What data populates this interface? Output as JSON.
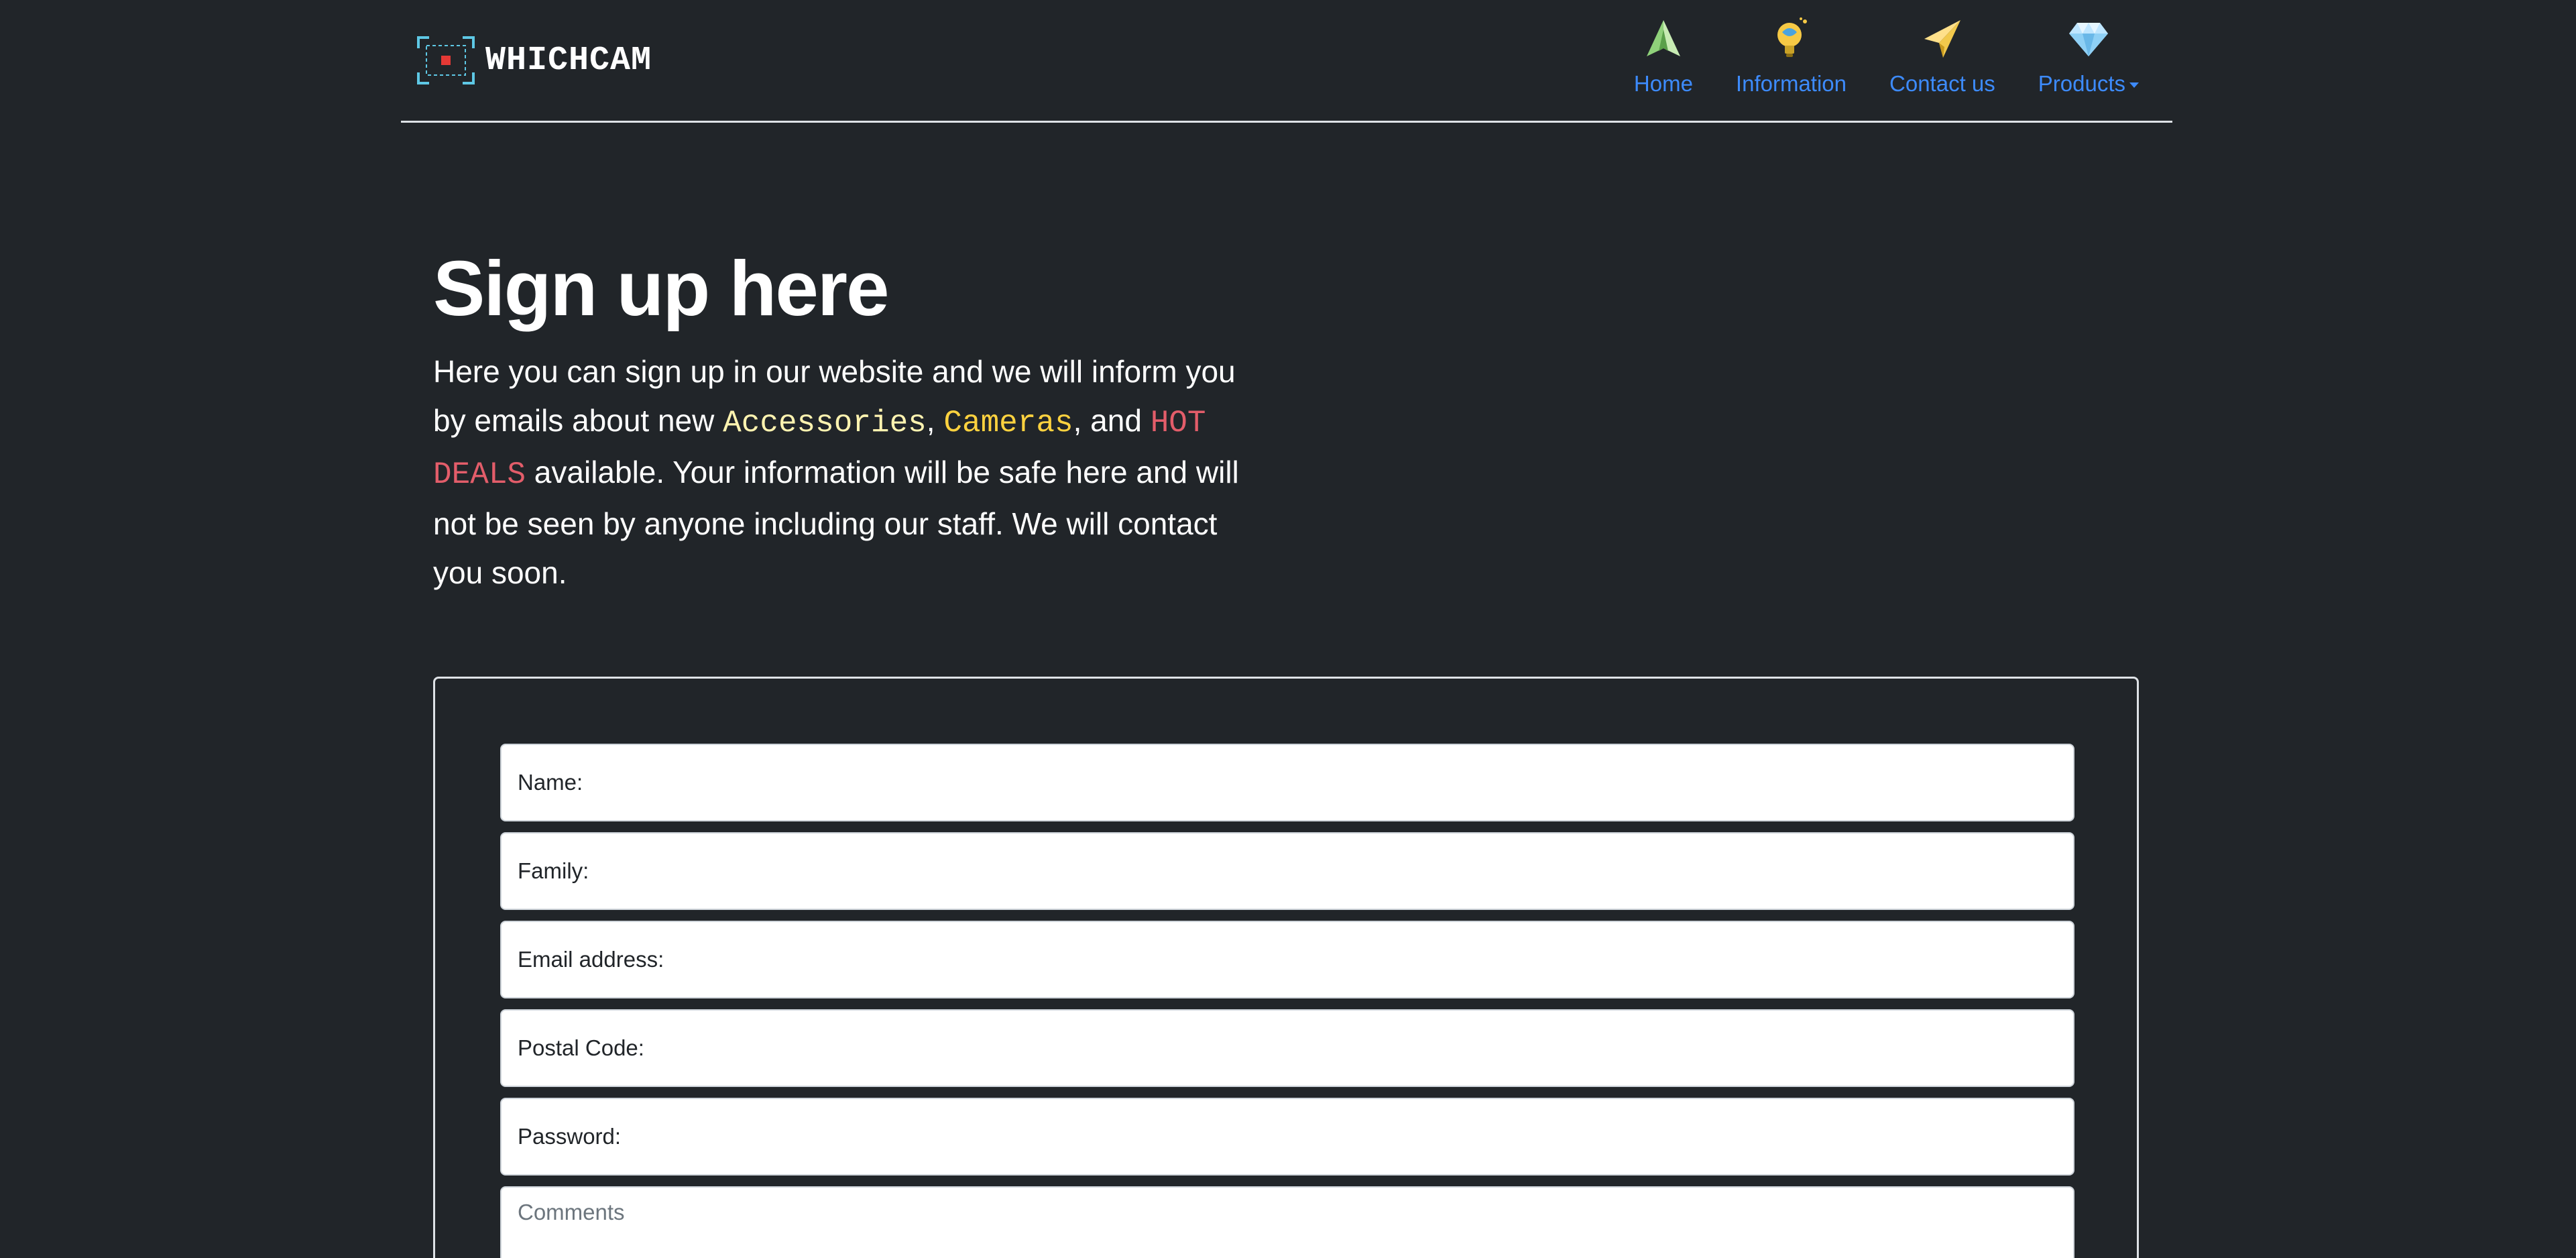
{
  "brand": {
    "name": "WHICHCAM"
  },
  "nav": {
    "items": [
      {
        "label": "Home",
        "icon": "paper-plane-icon"
      },
      {
        "label": "Information",
        "icon": "lightbulb-icon"
      },
      {
        "label": "Contact us",
        "icon": "send-arrow-icon"
      },
      {
        "label": "Products",
        "icon": "diamond-icon",
        "dropdown": true
      }
    ]
  },
  "hero": {
    "title": "Sign up here",
    "text_part1": "Here you can sign up in our website and we will inform you by emails about new ",
    "code_accessories": "Accessories",
    "sep1": ", ",
    "code_cameras": "Cameras",
    "sep2": ", and ",
    "code_hot_deals": "HOT DEALS",
    "text_part2": " available. Your information will be safe here and will not be seen by anyone including our staff. We will contact you soon."
  },
  "form": {
    "fields": [
      {
        "label": "Name:"
      },
      {
        "label": "Family:"
      },
      {
        "label": "Email address:"
      },
      {
        "label": "Postal Code:"
      },
      {
        "label": "Password:"
      }
    ],
    "comments_placeholder": "Comments"
  },
  "colors": {
    "background": "#212529",
    "link": "#3d8bfd",
    "accessories": "#fff3b0",
    "cameras": "#ffd23f",
    "hot_deals": "#e35d6a"
  }
}
